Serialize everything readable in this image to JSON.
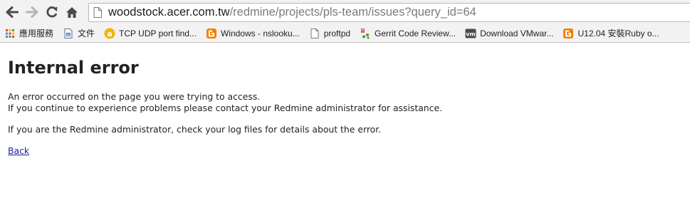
{
  "browser": {
    "url": {
      "host": "woodstock.acer.com.tw",
      "path": "/redmine/projects/pls-team/issues?query_id=64"
    },
    "bookmarks": [
      {
        "label": "應用服務",
        "icon": "apps-grid-icon"
      },
      {
        "label": "文件",
        "icon": "document-icon"
      },
      {
        "label": "TCP UDP port find...",
        "icon": "answers-icon"
      },
      {
        "label": "Windows - nslooku...",
        "icon": "blogger-icon"
      },
      {
        "label": "proftpd",
        "icon": "page-icon"
      },
      {
        "label": "Gerrit Code Review...",
        "icon": "gerrit-icon"
      },
      {
        "label": "Download VMwar...",
        "icon": "vmware-icon"
      },
      {
        "label": "U12.04 安裝Ruby o...",
        "icon": "blogger-icon"
      }
    ]
  },
  "page": {
    "title": "Internal error",
    "message_line1": "An error occurred on the page you were trying to access.",
    "message_line2": "If you continue to experience problems please contact your Redmine administrator for assistance.",
    "message_line3": "If you are the Redmine administrator, check your log files for details about the error.",
    "back_link": "Back"
  }
}
